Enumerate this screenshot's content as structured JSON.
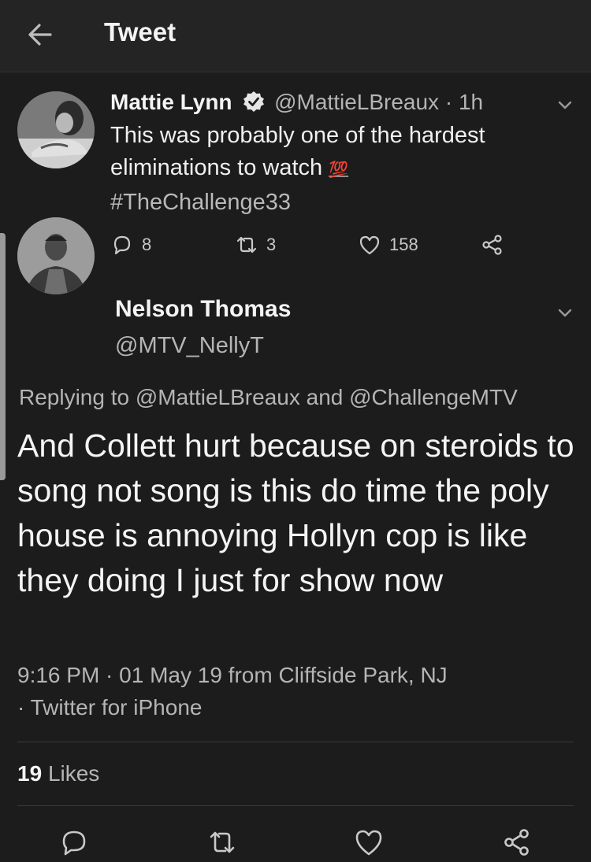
{
  "header": {
    "title": "Tweet",
    "back_icon": "arrow-left-icon"
  },
  "tweet1": {
    "name": "Mattie Lynn",
    "verified_icon": "verified-badge-icon",
    "handle": "@MattieLBreaux",
    "separator": "·",
    "time": "1h",
    "body_lines": [
      "This was probably one of the hardest",
      "eliminations to watch"
    ],
    "emoji": "💯",
    "hashtag": "#TheChallenge33",
    "reply_count": "8",
    "retweet_count": "3",
    "like_count": "158"
  },
  "tweet2": {
    "name": "Nelson Thomas",
    "handle": "@MTV_NellyT",
    "replying_prefix": "Replying to",
    "replying_user1": "@MattieLBreaux",
    "replying_and": "and",
    "replying_user2": "@ChallengeMTV",
    "body": "And Collett hurt because on steroids to song not song is this do time the poly house is annoying Hollyn cop is like they doing I just for show now",
    "timestamp": "9:16 PM · 01 May 19 from Cliffside Park, NJ",
    "client": "· Twitter for iPhone",
    "likes_count": "19",
    "likes_label": "Likes"
  },
  "colors": {
    "background": "#1c1c1c",
    "header": "#242424",
    "text": "#f4f4f4",
    "muted": "#b5b5b5"
  }
}
